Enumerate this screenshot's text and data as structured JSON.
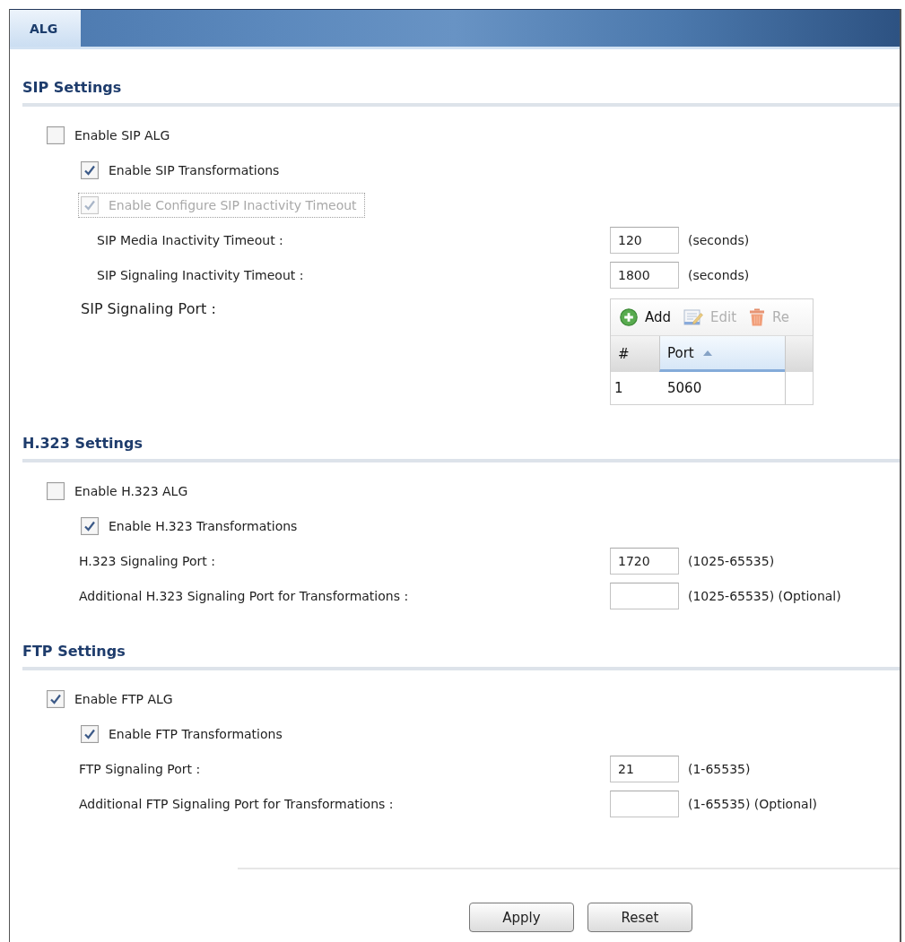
{
  "tabs": [
    {
      "label": "ALG",
      "selected": true
    }
  ],
  "sections": [
    {
      "title": "SIP Settings",
      "items": [
        {
          "kind": "checkbox",
          "label": "Enable SIP ALG",
          "checked": false,
          "disabled": false,
          "focused": false,
          "children": [
            {
              "kind": "checkbox",
              "label": "Enable SIP Transformations",
              "checked": true,
              "disabled": false,
              "focused": false
            },
            {
              "kind": "checkbox",
              "label": "Enable Configure SIP Inactivity Timeout",
              "checked": true,
              "disabled": true,
              "focused": true,
              "children": [
                {
                  "kind": "field",
                  "label": "SIP Media Inactivity Timeout :",
                  "value": "120",
                  "hint": "(seconds)"
                },
                {
                  "kind": "field",
                  "label": "SIP Signaling Inactivity Timeout :",
                  "value": "1800",
                  "hint": "(seconds)"
                }
              ]
            },
            {
              "kind": "table",
              "label": "SIP Signaling Port :",
              "toolbar": [
                {
                  "kind": "add",
                  "label": "Add",
                  "disabled": false
                },
                {
                  "kind": "edit",
                  "label": "Edit",
                  "disabled": true
                },
                {
                  "kind": "remove",
                  "label": "Re",
                  "disabled": true
                }
              ],
              "columns": [
                {
                  "label": "#",
                  "sorted": false
                },
                {
                  "label": "Port",
                  "sorted": true
                }
              ],
              "rows": [
                [
                  "1",
                  "5060"
                ]
              ]
            }
          ]
        }
      ]
    },
    {
      "title": "H.323 Settings",
      "items": [
        {
          "kind": "checkbox",
          "label": "Enable H.323 ALG",
          "checked": false,
          "disabled": false,
          "focused": false,
          "children": [
            {
              "kind": "checkbox",
              "label": "Enable H.323 Transformations",
              "checked": true,
              "disabled": false,
              "focused": false
            },
            {
              "kind": "field",
              "label": "H.323 Signaling Port :",
              "value": "1720",
              "hint": "(1025-65535)"
            },
            {
              "kind": "field",
              "label": "Additional H.323 Signaling Port for Transformations :",
              "hint": "(1025-65535) (Optional)"
            }
          ]
        }
      ]
    },
    {
      "title": "FTP Settings",
      "items": [
        {
          "kind": "checkbox",
          "label": "Enable FTP ALG",
          "checked": true,
          "disabled": false,
          "focused": false,
          "children": [
            {
              "kind": "checkbox",
              "label": "Enable FTP Transformations",
              "checked": true,
              "disabled": false,
              "focused": false
            },
            {
              "kind": "field",
              "label": "FTP Signaling Port :",
              "value": "21",
              "hint": "(1-65535)"
            },
            {
              "kind": "field",
              "label": "Additional FTP Signaling Port for Transformations :",
              "hint": "(1-65535) (Optional)"
            }
          ]
        }
      ]
    }
  ],
  "buttons": [
    {
      "label": "Apply"
    },
    {
      "label": "Reset"
    }
  ]
}
